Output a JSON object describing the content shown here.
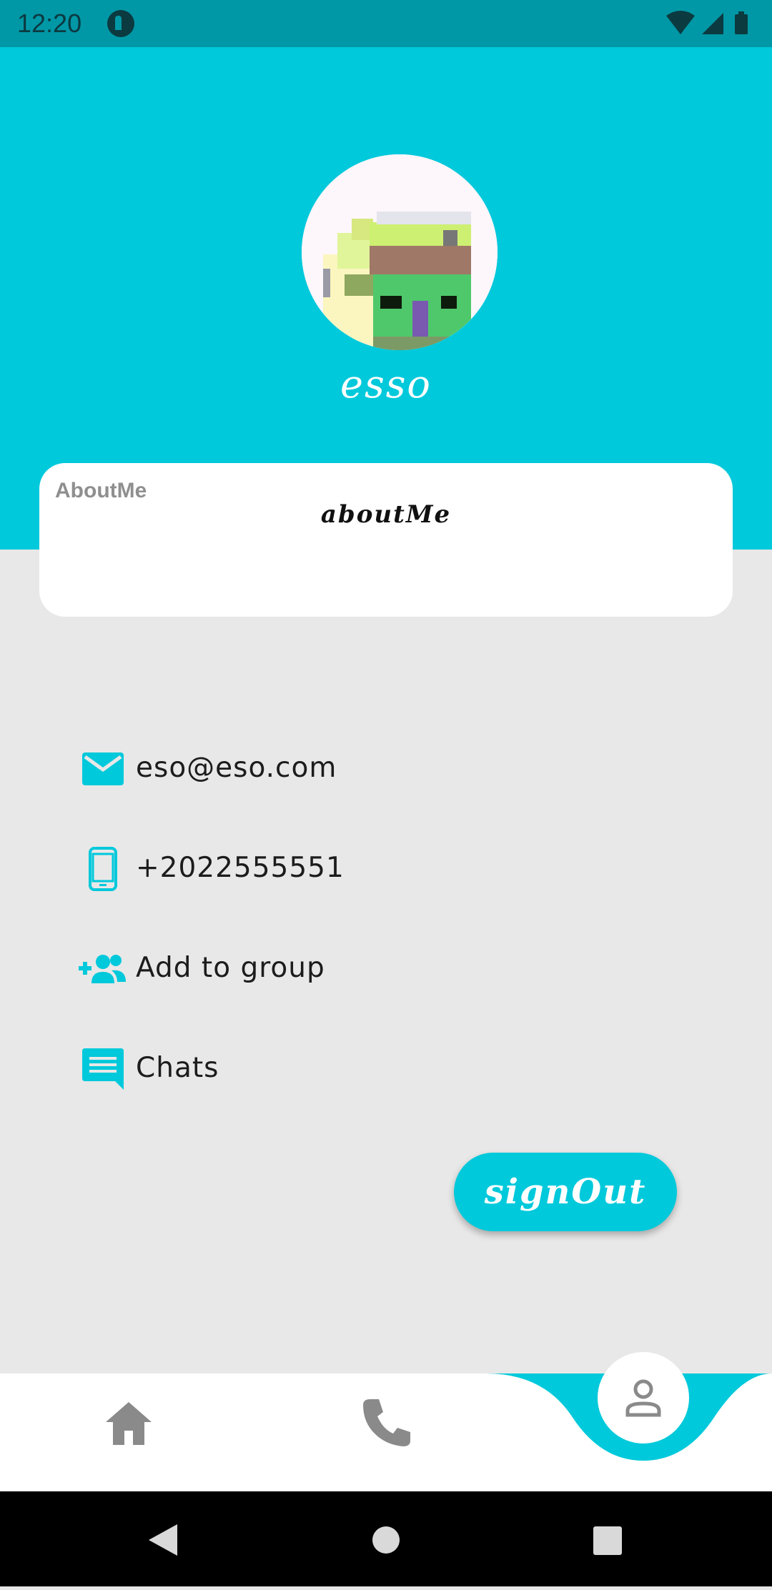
{
  "status_bar": {
    "time": "12:20"
  },
  "profile": {
    "name": "esso",
    "about_label": "AboutMe",
    "about_value": "aboutMe"
  },
  "info": {
    "email": "eso@eso.com",
    "phone": "+2022555551",
    "add_group": "Add to group",
    "chats": "Chats"
  },
  "actions": {
    "signout_label": "signOut"
  },
  "bottom_nav": {
    "items": [
      {
        "icon": "home-icon"
      },
      {
        "icon": "phone-icon"
      },
      {
        "icon": "profile-icon",
        "active": true
      }
    ]
  },
  "colors": {
    "accent": "#00c9db",
    "status_bar": "#0097a7",
    "background": "#e8e8e8",
    "icon_gray": "#8a8a8a"
  }
}
